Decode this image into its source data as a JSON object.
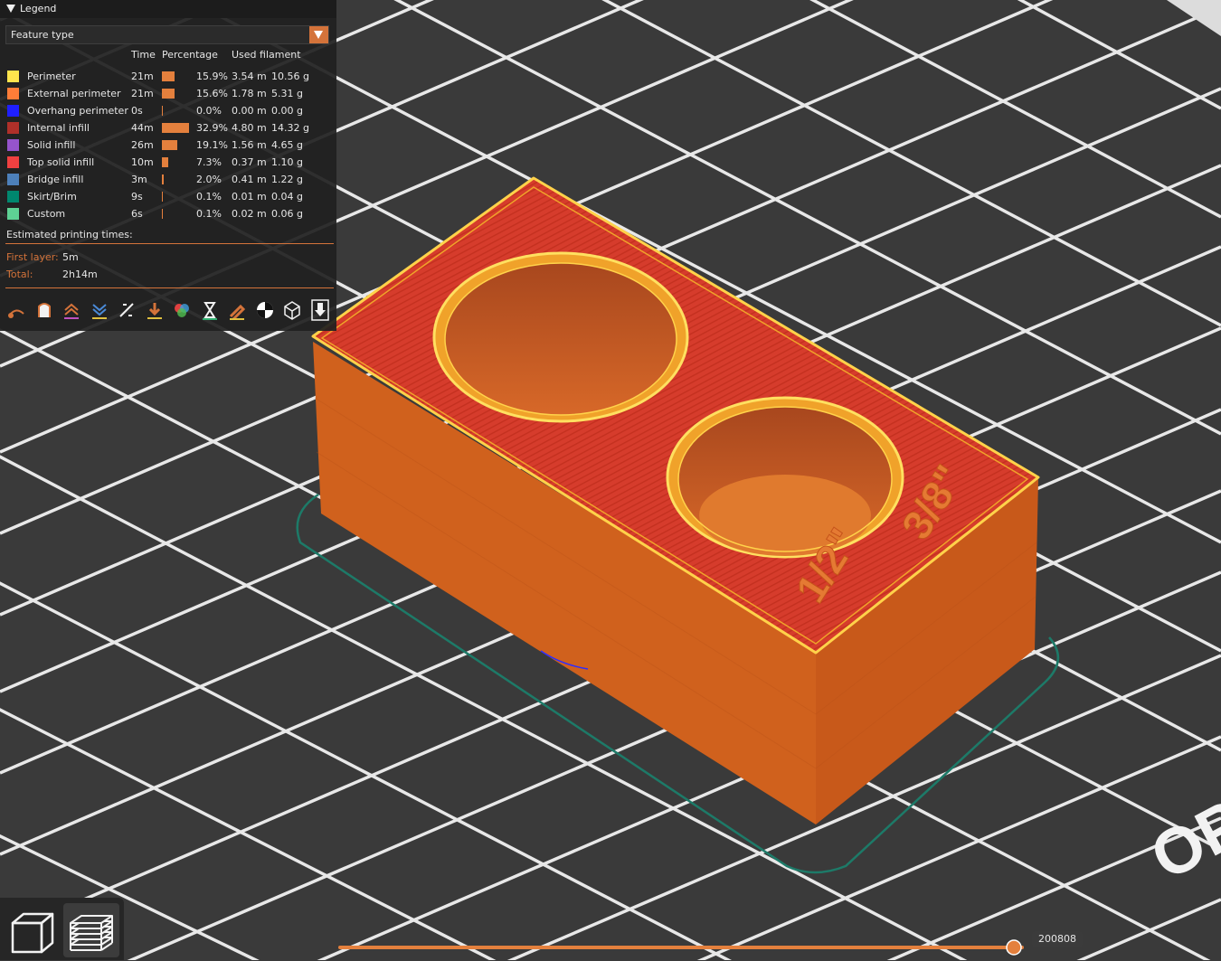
{
  "legend": {
    "title": "Legend",
    "view_type": "Feature type",
    "columns": {
      "time": "Time",
      "percentage": "Percentage",
      "used_filament": "Used filament"
    },
    "features": [
      {
        "name": "Perimeter",
        "color": "#ffe54d",
        "time": "21m",
        "percentage": "15.9%",
        "share": 0.159,
        "length": "3.54 m",
        "weight": "10.56 g"
      },
      {
        "name": "External perimeter",
        "color": "#ff7d38",
        "time": "21m",
        "percentage": "15.6%",
        "share": 0.156,
        "length": "1.78 m",
        "weight": "5.31 g"
      },
      {
        "name": "Overhang perimeter",
        "color": "#1f1fff",
        "time": "0s",
        "percentage": "0.0%",
        "share": 0.0,
        "length": "0.00 m",
        "weight": "0.00 g"
      },
      {
        "name": "Internal infill",
        "color": "#b03029",
        "time": "44m",
        "percentage": "32.9%",
        "share": 0.329,
        "length": "4.80 m",
        "weight": "14.32 g"
      },
      {
        "name": "Solid infill",
        "color": "#9654cc",
        "time": "26m",
        "percentage": "19.1%",
        "share": 0.191,
        "length": "1.56 m",
        "weight": "4.65 g"
      },
      {
        "name": "Top solid infill",
        "color": "#f04040",
        "time": "10m",
        "percentage": "7.3%",
        "share": 0.073,
        "length": "0.37 m",
        "weight": "1.10 g"
      },
      {
        "name": "Bridge infill",
        "color": "#4d80ba",
        "time": "3m",
        "percentage": "2.0%",
        "share": 0.02,
        "length": "0.41 m",
        "weight": "1.22 g"
      },
      {
        "name": "Skirt/Brim",
        "color": "#00876e",
        "time": "9s",
        "percentage": "0.1%",
        "share": 0.001,
        "length": "0.01 m",
        "weight": "0.04 g"
      },
      {
        "name": "Custom",
        "color": "#5ed194",
        "time": "6s",
        "percentage": "0.1%",
        "share": 0.001,
        "length": "0.02 m",
        "weight": "0.06 g"
      }
    ],
    "estimated_label": "Estimated printing times:",
    "first_layer_label": "First layer:",
    "first_layer_value": "5m",
    "total_label": "Total:",
    "total_value": "2h14m",
    "tools": [
      "travel-icon",
      "wipe-icon",
      "retractions-icon",
      "deretractions-icon",
      "seams-icon",
      "tool-changes-icon",
      "color-changes-icon",
      "pause-prints-icon",
      "custom-gcodes-icon",
      "center-of-gravity-icon",
      "shells-icon",
      "tool-marker-icon"
    ]
  },
  "model": {
    "label_left": "1/2\"",
    "label_right": "3/8\"",
    "colors": {
      "wall": "#d2651e",
      "top": "#d63c2c",
      "perimeter": "#ffd24a",
      "skirt": "#1d7a68"
    }
  },
  "bed": {
    "corner_text": "OP"
  },
  "slider": {
    "value": "200808",
    "position": 1.0
  }
}
